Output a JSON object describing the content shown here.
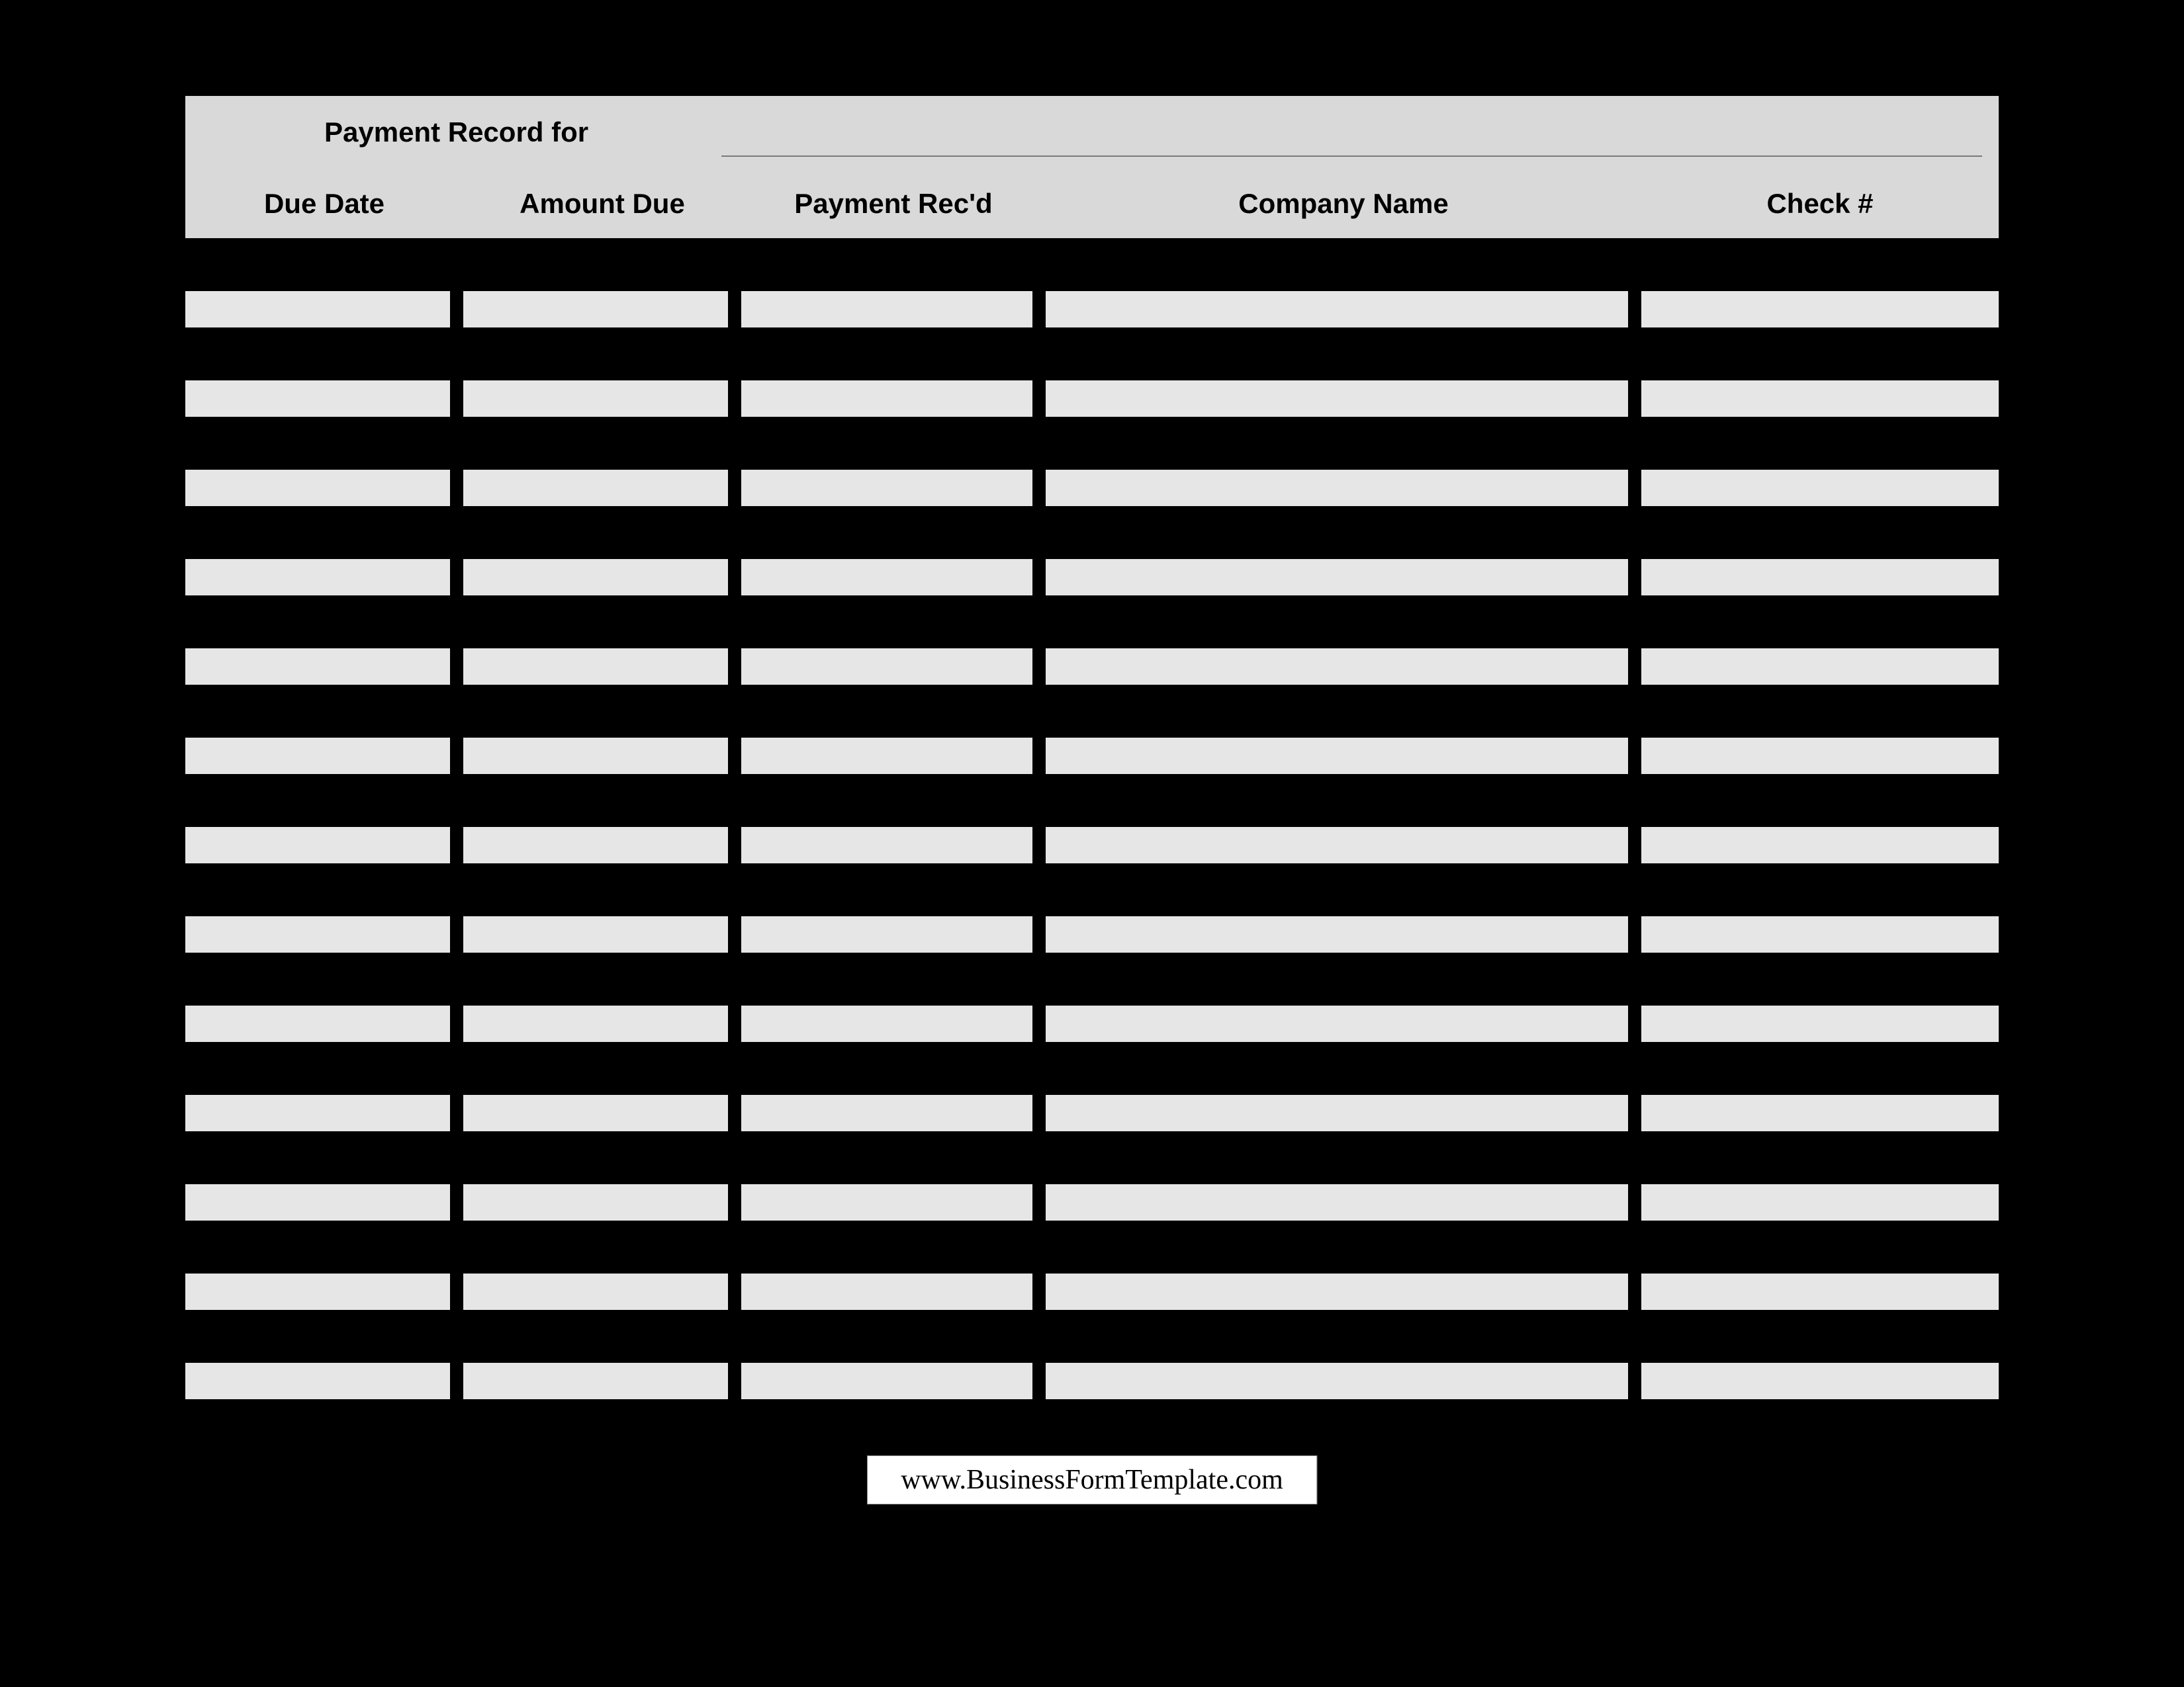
{
  "header": {
    "title": "Payment Record for",
    "recipient": ""
  },
  "columns": {
    "due_date": "Due Date",
    "amount_due": "Amount Due",
    "payment_recd": "Payment Rec'd",
    "company_name": "Company Name",
    "check_no": "Check #"
  },
  "rows": [
    {
      "due_date": "",
      "amount_due": "",
      "payment_recd": "",
      "company_name": "",
      "check_no": ""
    },
    {
      "due_date": "",
      "amount_due": "",
      "payment_recd": "",
      "company_name": "",
      "check_no": ""
    },
    {
      "due_date": "",
      "amount_due": "",
      "payment_recd": "",
      "company_name": "",
      "check_no": ""
    },
    {
      "due_date": "",
      "amount_due": "",
      "payment_recd": "",
      "company_name": "",
      "check_no": ""
    },
    {
      "due_date": "",
      "amount_due": "",
      "payment_recd": "",
      "company_name": "",
      "check_no": ""
    },
    {
      "due_date": "",
      "amount_due": "",
      "payment_recd": "",
      "company_name": "",
      "check_no": ""
    },
    {
      "due_date": "",
      "amount_due": "",
      "payment_recd": "",
      "company_name": "",
      "check_no": ""
    },
    {
      "due_date": "",
      "amount_due": "",
      "payment_recd": "",
      "company_name": "",
      "check_no": ""
    },
    {
      "due_date": "",
      "amount_due": "",
      "payment_recd": "",
      "company_name": "",
      "check_no": ""
    },
    {
      "due_date": "",
      "amount_due": "",
      "payment_recd": "",
      "company_name": "",
      "check_no": ""
    },
    {
      "due_date": "",
      "amount_due": "",
      "payment_recd": "",
      "company_name": "",
      "check_no": ""
    },
    {
      "due_date": "",
      "amount_due": "",
      "payment_recd": "",
      "company_name": "",
      "check_no": ""
    },
    {
      "due_date": "",
      "amount_due": "",
      "payment_recd": "",
      "company_name": "",
      "check_no": ""
    }
  ],
  "footer": {
    "url": "www.BusinessFormTemplate.com"
  }
}
